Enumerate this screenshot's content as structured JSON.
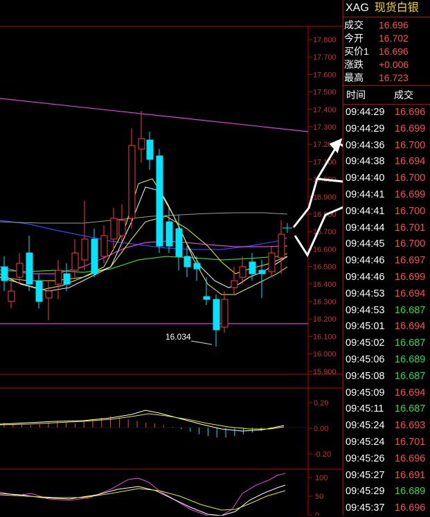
{
  "header": {
    "symbol": "XAG",
    "name": "现货白银"
  },
  "quote": [
    {
      "label": "成交",
      "value": "16.696",
      "color": "#ff4c4c"
    },
    {
      "label": "今开",
      "value": "16.702",
      "color": "#ff4c4c"
    },
    {
      "label": "买价1",
      "value": "16.696",
      "color": "#ff4c4c"
    },
    {
      "label": "涨跌",
      "value": "+0.006",
      "color": "#ff4c4c"
    },
    {
      "label": "最高",
      "value": "16.723",
      "color": "#ff4c4c"
    }
  ],
  "ticks_header": {
    "time": "时间",
    "price": "成交"
  },
  "ticks": [
    {
      "time": "09:44:29",
      "price": "16.696",
      "color": "red"
    },
    {
      "time": "09:44:29",
      "price": "16.699",
      "color": "red"
    },
    {
      "time": "09:44:36",
      "price": "16.700",
      "color": "red"
    },
    {
      "time": "09:44:38",
      "price": "16.694",
      "color": "red"
    },
    {
      "time": "09:44:40",
      "price": "16.700",
      "color": "red"
    },
    {
      "time": "09:44:41",
      "price": "16.699",
      "color": "red"
    },
    {
      "time": "09:44:41",
      "price": "16.700",
      "color": "red"
    },
    {
      "time": "09:44:44",
      "price": "16.701",
      "color": "red"
    },
    {
      "time": "09:44:45",
      "price": "16.700",
      "color": "red"
    },
    {
      "time": "09:44:46",
      "price": "16.697",
      "color": "red"
    },
    {
      "time": "09:44:46",
      "price": "16.699",
      "color": "red"
    },
    {
      "time": "09:44:53",
      "price": "16.694",
      "color": "red"
    },
    {
      "time": "09:44:53",
      "price": "16.687",
      "color": "green"
    },
    {
      "time": "09:45:01",
      "price": "16.694",
      "color": "red"
    },
    {
      "time": "09:45:02",
      "price": "16.687",
      "color": "green"
    },
    {
      "time": "09:45:06",
      "price": "16.689",
      "color": "green"
    },
    {
      "time": "09:45:08",
      "price": "16.687",
      "color": "green"
    },
    {
      "time": "09:45:09",
      "price": "16.694",
      "color": "red"
    },
    {
      "time": "09:45:11",
      "price": "16.687",
      "color": "green"
    },
    {
      "time": "09:45:24",
      "price": "16.693",
      "color": "red"
    },
    {
      "time": "09:45:24",
      "price": "16.701",
      "color": "red"
    },
    {
      "time": "09:45:26",
      "price": "16.696",
      "color": "red"
    },
    {
      "time": "09:45:27",
      "price": "16.691",
      "color": "red"
    },
    {
      "time": "09:45:29",
      "price": "16.689",
      "color": "green"
    },
    {
      "time": "09:45:37",
      "price": "16.696",
      "color": "red"
    }
  ],
  "chart_data": {
    "type": "candlestick",
    "price_axis": [
      "17.800",
      "17.700",
      "17.600",
      "17.500",
      "17.400",
      "17.300",
      "17.200",
      "17.100",
      "17.000",
      "16.900",
      "16.800",
      "16.700",
      "16.600",
      "16.500",
      "16.400",
      "16.300",
      "16.200",
      "16.100",
      "16.000",
      "15.900"
    ],
    "low_annotation": "16.034",
    "macd_axis": [
      "0.20",
      "0.00",
      "-0.20"
    ],
    "kdj_axis": [
      "100",
      "50",
      "0"
    ],
    "colors": {
      "up": "#ff3b3b",
      "down": "#00e5ff",
      "grid": "#c00000"
    }
  }
}
